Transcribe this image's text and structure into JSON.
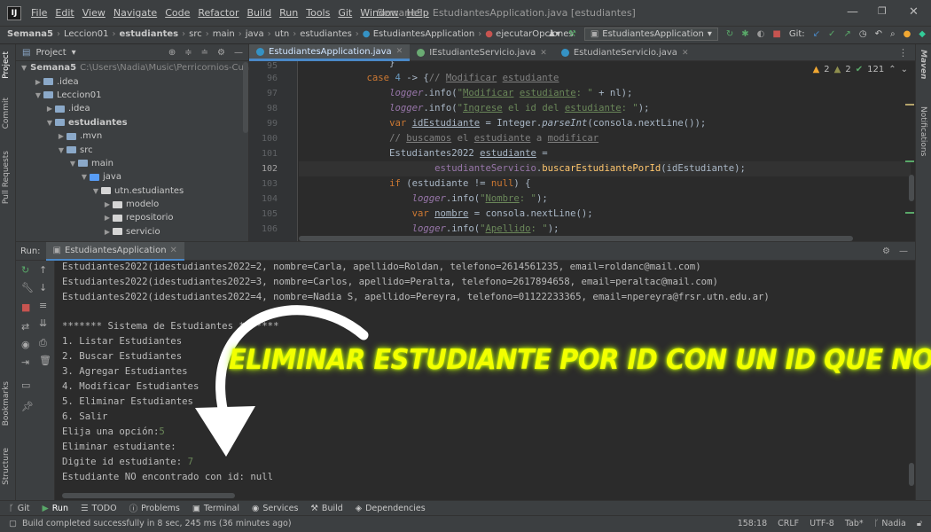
{
  "titlebar": {
    "menus": [
      "File",
      "Edit",
      "View",
      "Navigate",
      "Code",
      "Refactor",
      "Build",
      "Run",
      "Tools",
      "Git",
      "Window",
      "Help"
    ],
    "window_title": "Semana5 - EstudiantesApplication.java [estudiantes]"
  },
  "navbar": {
    "crumbs": [
      "Semana5",
      "Leccion01",
      "estudiantes",
      "src",
      "main",
      "java",
      "utn",
      "estudiantes",
      "EstudiantesApplication",
      "ejecutarOpciones"
    ],
    "run_config": "EstudiantesApplication",
    "git_label": "Git:"
  },
  "left_stripe": [
    "Project",
    "Commit",
    "Pull Requests",
    "Bookmarks",
    "Structure"
  ],
  "right_stripe": [
    "Maven",
    "Notifications"
  ],
  "project": {
    "title": "Project",
    "tree": [
      {
        "label": "Semana5",
        "hint": "C:\\Users\\Nadia\\Music\\Perricornios-Cuarto-Se",
        "indent": 0,
        "arrow": "▼",
        "kind": "folder",
        "bold": true
      },
      {
        "label": ".idea",
        "indent": 1,
        "arrow": "▶",
        "kind": "folder"
      },
      {
        "label": "Leccion01",
        "indent": 1,
        "arrow": "▼",
        "kind": "folder"
      },
      {
        "label": ".idea",
        "indent": 2,
        "arrow": "▶",
        "kind": "folder"
      },
      {
        "label": "estudiantes",
        "indent": 2,
        "arrow": "▼",
        "kind": "folder",
        "bold": true
      },
      {
        "label": ".mvn",
        "indent": 3,
        "arrow": "▶",
        "kind": "folder"
      },
      {
        "label": "src",
        "indent": 3,
        "arrow": "▼",
        "kind": "folder"
      },
      {
        "label": "main",
        "indent": 4,
        "arrow": "▼",
        "kind": "folder"
      },
      {
        "label": "java",
        "indent": 5,
        "arrow": "▼",
        "kind": "src"
      },
      {
        "label": "utn.estudiantes",
        "indent": 6,
        "arrow": "▼",
        "kind": "pkg"
      },
      {
        "label": "modelo",
        "indent": 7,
        "arrow": "▶",
        "kind": "pkg"
      },
      {
        "label": "repositorio",
        "indent": 7,
        "arrow": "▶",
        "kind": "pkg"
      },
      {
        "label": "servicio",
        "indent": 7,
        "arrow": "▶",
        "kind": "pkg"
      }
    ]
  },
  "tabs": [
    {
      "label": "EstudiantesApplication.java",
      "active": true,
      "icon": "class-icon"
    },
    {
      "label": "IEstudianteServicio.java",
      "active": false,
      "icon": "interface-icon"
    },
    {
      "label": "EstudianteServicio.java",
      "active": false,
      "icon": "class-icon"
    }
  ],
  "inspection": {
    "warn_a": "2",
    "warn_b": "2",
    "ok": "121"
  },
  "editor": {
    "line_numbers": [
      "95",
      "96",
      "97",
      "98",
      "99",
      "100",
      "101",
      "102",
      "103",
      "104",
      "105",
      "106"
    ],
    "current_line": "102"
  },
  "run": {
    "label": "Run:",
    "tab": "EstudiantesApplication",
    "console": [
      "Estudiantes2022(idestudiantes2022=2, nombre=Carla, apellido=Roldan, telefono=2614561235, email=roldanc@mail.com)",
      "Estudiantes2022(idestudiantes2022=3, nombre=Carlos, apellido=Peralta, telefono=2617894658, email=peraltac@mail.com)",
      "Estudiantes2022(idestudiantes2022=4, nombre=Nadia S, apellido=Pereyra, telefono=01122233365, email=npereyra@frsr.utn.edu.ar)",
      "",
      "******* Sistema de Estudiantes *******",
      "1. Listar Estudiantes",
      "2. Buscar Estudiantes",
      "3. Agregar Estudiantes",
      "4. Modificar Estudiantes",
      "5. Eliminar Estudiantes",
      "6. Salir",
      "Elija una opción:",
      "Eliminar estudiante:",
      "Digite id estudiante: ",
      "Estudiante NO encontrado con id: null"
    ],
    "input_option": "5",
    "input_id": "7"
  },
  "overlay_text": "ELIMINAR  ESTUDIANTE POR ID CON UN ID QUE NO EXISTE",
  "bottom_tabs": [
    "Git",
    "Run",
    "TODO",
    "Problems",
    "Terminal",
    "Services",
    "Build",
    "Dependencies"
  ],
  "status": {
    "message": "Build completed successfully in 8 sec, 245 ms (36 minutes ago)",
    "position": "158:18",
    "line_sep": "CRLF",
    "encoding": "UTF-8",
    "indent": "Tab*",
    "user": "Nadia"
  },
  "colors": {
    "accent": "#4a88c7",
    "overlay": "#f2ff00",
    "keyword": "#cc7832",
    "string": "#6a8759"
  }
}
